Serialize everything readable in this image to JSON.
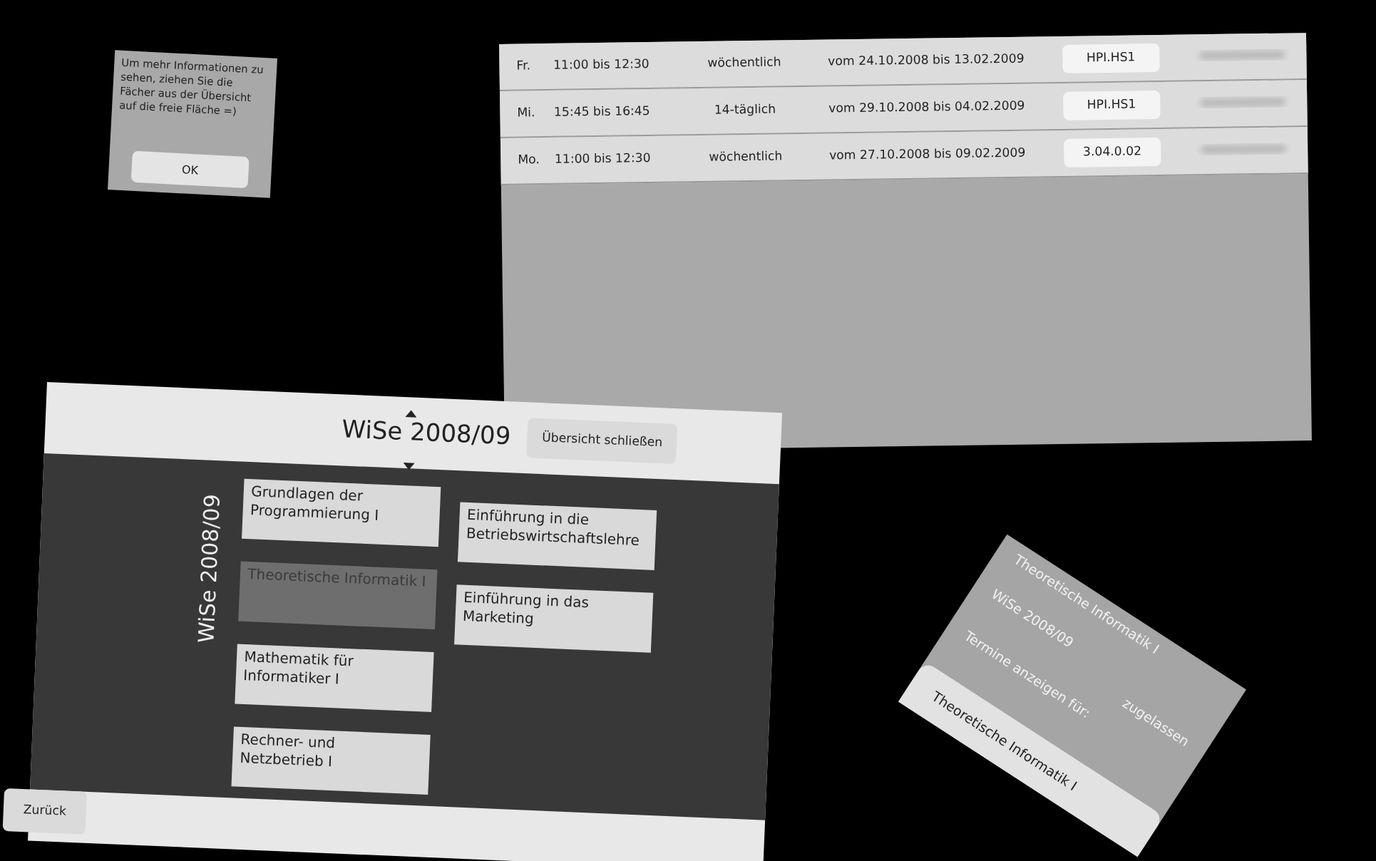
{
  "dialog": {
    "message": "Um mehr Informationen zu sehen, ziehen Sie die Fächer aus der Übersicht auf die freie Fläche =)",
    "button": "OK"
  },
  "schedule": {
    "rows": [
      {
        "day": "Fr.",
        "time": "11:00 bis 12:30",
        "frequency": "wöchentlich",
        "period": "vom 24.10.2008 bis 13.02.2009",
        "room": "HPI.HS1"
      },
      {
        "day": "Mi.",
        "time": "15:45 bis 16:45",
        "frequency": "14-täglich",
        "period": "vom 29.10.2008 bis 04.02.2009",
        "room": "HPI.HS1"
      },
      {
        "day": "Mo.",
        "time": "11:00 bis 12:30",
        "frequency": "wöchentlich",
        "period": "vom 27.10.2008 bis 09.02.2009",
        "room": "3.04.0.02"
      }
    ]
  },
  "overview": {
    "title": "WiSe 2008/09",
    "close_button": "Übersicht schließen",
    "side_label": "WiSe 2008/09",
    "courses": [
      {
        "label": "Grundlagen der Programmierung I",
        "selected": false
      },
      {
        "label": "Theoretische Informatik I",
        "selected": true
      },
      {
        "label": "Mathematik für Informatiker I",
        "selected": false
      },
      {
        "label": "Rechner- und Netzbetrieb I",
        "selected": false
      },
      {
        "label": "Einführung in die Betriebswirtschaftslehre",
        "selected": false
      },
      {
        "label": "Einführung in das Marketing",
        "selected": false
      }
    ],
    "back_button": "Zurück"
  },
  "course_card": {
    "title": "Theoretische Informatik I",
    "semester": "WiSe 2008/09",
    "status": "zugelassen",
    "prompt": "Termine anzeigen für:",
    "button": "Theoretische Informatik I"
  }
}
